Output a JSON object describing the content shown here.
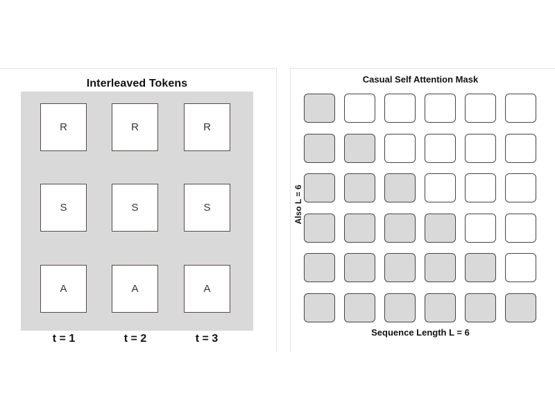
{
  "interleaved": {
    "title": "Interleaved Tokens",
    "rows": [
      [
        "R",
        "R",
        "R"
      ],
      [
        "S",
        "S",
        "S"
      ],
      [
        "A",
        "A",
        "A"
      ]
    ],
    "timesteps": [
      "t = 1",
      "t = 2",
      "t = 3"
    ]
  },
  "attention_mask": {
    "title": "Casual Self Attention Mask",
    "x_label": "Sequence Length L = 6",
    "y_label": "Also L = 6",
    "size": 6,
    "masked_color": "#d9d9d9",
    "unmasked_color": "#ffffff"
  }
}
